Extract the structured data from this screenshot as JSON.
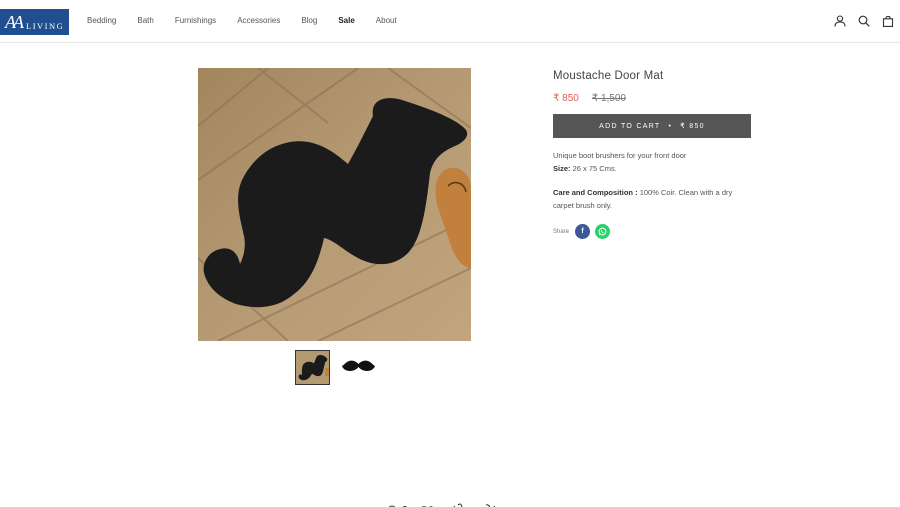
{
  "brand": {
    "mark": "AA",
    "name": "LIVING",
    "color": "#1f4f8f"
  },
  "nav": {
    "items": [
      {
        "label": "Bedding"
      },
      {
        "label": "Bath"
      },
      {
        "label": "Furnishings"
      },
      {
        "label": "Accessories"
      },
      {
        "label": "Blog"
      },
      {
        "label": "Sale"
      },
      {
        "label": "About"
      }
    ]
  },
  "header_icons": [
    "account-icon",
    "search-icon",
    "cart-bag-icon"
  ],
  "gallery": {
    "main_image": "moustache-door-mat-photo",
    "thumbnails": [
      "mat-photo-thumbnail",
      "moustache-silhouette-thumbnail"
    ],
    "active_thumbnail": 0
  },
  "product": {
    "title": "Moustache Door Mat",
    "price": "₹ 850",
    "compare_price": "₹ 1,500",
    "sale_color": "#e45d4f",
    "add_to_cart": {
      "label": "ADD TO CART",
      "separator": "•",
      "price": "₹ 850"
    },
    "description": "Unique boot brushers for your front door",
    "size_label": "Size:",
    "size_value": "26 x 75 Cms.",
    "care_label": "Care and Composition :",
    "care_value": "100% Coir. Clean with a dry carpet brush only."
  },
  "share": {
    "label": "Share",
    "facebook": "f",
    "whatsapp_icon": "whatsapp-icon"
  }
}
